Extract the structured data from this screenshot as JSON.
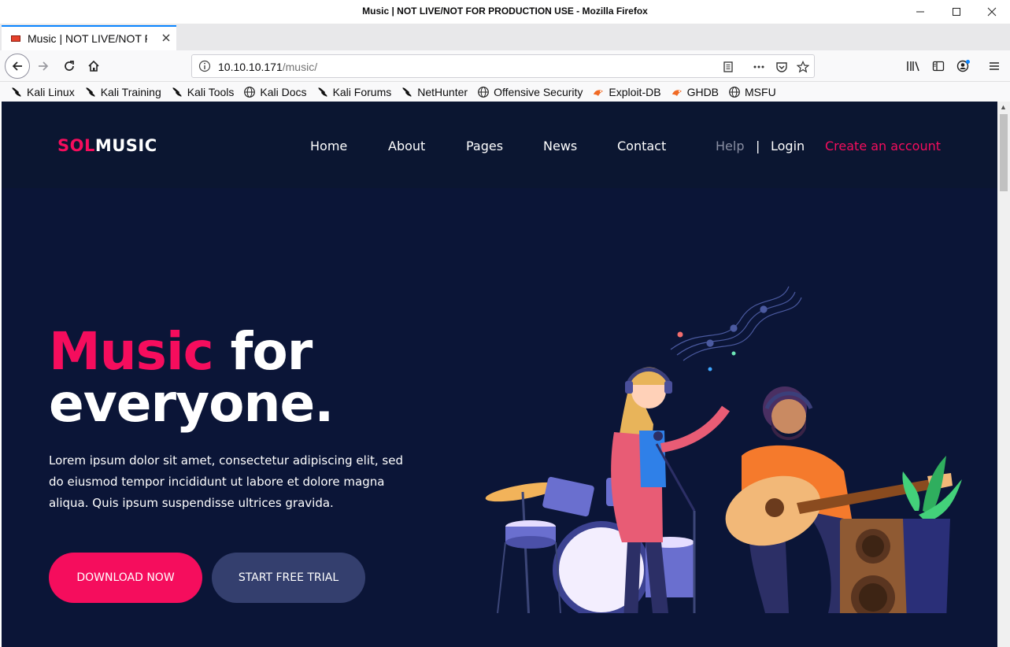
{
  "window": {
    "title": "Music | NOT LIVE/NOT FOR PRODUCTION USE - Mozilla Firefox",
    "controls": {
      "minimize": "–",
      "maximize": "☐",
      "close": "✕"
    }
  },
  "tab": {
    "title": "Music | NOT LIVE/NOT FOR PRODUCTION USE",
    "close": "✕",
    "new_tab": "+"
  },
  "urlbar": {
    "host": "10.10.10.171",
    "path": "/music/"
  },
  "bookmarks": [
    {
      "label": "Kali Linux",
      "icon": "kali-dragon-icon"
    },
    {
      "label": "Kali Training",
      "icon": "kali-dragon-icon"
    },
    {
      "label": "Kali Tools",
      "icon": "kali-dragon-icon"
    },
    {
      "label": "Kali Docs",
      "icon": "globe-icon"
    },
    {
      "label": "Kali Forums",
      "icon": "kali-dragon-icon"
    },
    {
      "label": "NetHunter",
      "icon": "kali-dragon-icon"
    },
    {
      "label": "Offensive Security",
      "icon": "globe-icon"
    },
    {
      "label": "Exploit-DB",
      "icon": "exploit-db-icon"
    },
    {
      "label": "GHDB",
      "icon": "exploit-db-icon"
    },
    {
      "label": "MSFU",
      "icon": "globe-icon"
    }
  ],
  "site": {
    "logo": {
      "part1": "SOL",
      "part2": "MUSIC"
    },
    "nav": [
      "Home",
      "About",
      "Pages",
      "News",
      "Contact"
    ],
    "help": "Help",
    "separator": "|",
    "login": "Login",
    "signup": "Create an account",
    "hero": {
      "headline_accent": "Music",
      "headline_rest": " for",
      "headline_line2": "everyone.",
      "lead": "Lorem ipsum dolor sit amet, consectetur adipiscing elit, sed do eiusmod tempor incididunt ut labore et dolore magna aliqua. Quis ipsum suspendisse ultrices gravida.",
      "download_button": "DOWNLOAD NOW",
      "trial_button": "START FREE TRIAL"
    }
  },
  "colors": {
    "accent": "#f50d5d",
    "header_bg": "#0b1631",
    "hero_bg": "#0b1537",
    "secondary_button": "#343f6e"
  }
}
